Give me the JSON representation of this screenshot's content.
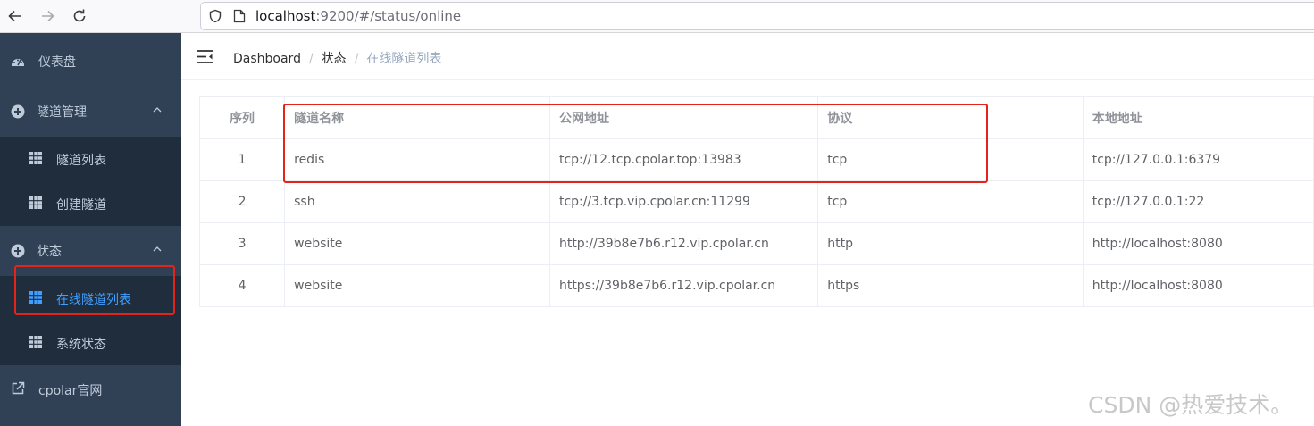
{
  "browser": {
    "url_host": "localhost",
    "url_rest": ":9200/#/status/online"
  },
  "sidebar": {
    "items": [
      {
        "label": "仪表盘",
        "icon": "dashboard-icon"
      },
      {
        "label": "隧道管理",
        "icon": "circle-plus-icon",
        "expanded": true,
        "children": [
          {
            "label": "隧道列表"
          },
          {
            "label": "创建隧道"
          }
        ]
      },
      {
        "label": "状态",
        "icon": "circle-plus-icon",
        "expanded": true,
        "children": [
          {
            "label": "在线隧道列表",
            "active": true
          },
          {
            "label": "系统状态"
          }
        ]
      },
      {
        "label": "cpolar官网",
        "icon": "external-link-icon"
      }
    ]
  },
  "breadcrumb": [
    "Dashboard",
    "状态",
    "在线隧道列表"
  ],
  "table": {
    "columns": [
      "序列",
      "隧道名称",
      "公网地址",
      "协议",
      "本地地址"
    ],
    "rows": [
      [
        "1",
        "redis",
        "tcp://12.tcp.cpolar.top:13983",
        "tcp",
        "tcp://127.0.0.1:6379"
      ],
      [
        "2",
        "ssh",
        "tcp://3.tcp.vip.cpolar.cn:11299",
        "tcp",
        "tcp://127.0.0.1:22"
      ],
      [
        "3",
        "website",
        "http://39b8e7b6.r12.vip.cpolar.cn",
        "http",
        "http://localhost:8080"
      ],
      [
        "4",
        "website",
        "https://39b8e7b6.r12.vip.cpolar.cn",
        "https",
        "http://localhost:8080"
      ]
    ]
  },
  "watermark": "CSDN @热爱技术。",
  "colors": {
    "sidebar_bg": "#304156",
    "submenu_bg": "#1f2d3d",
    "active": "#409eff",
    "annotation": "#e3241b"
  }
}
